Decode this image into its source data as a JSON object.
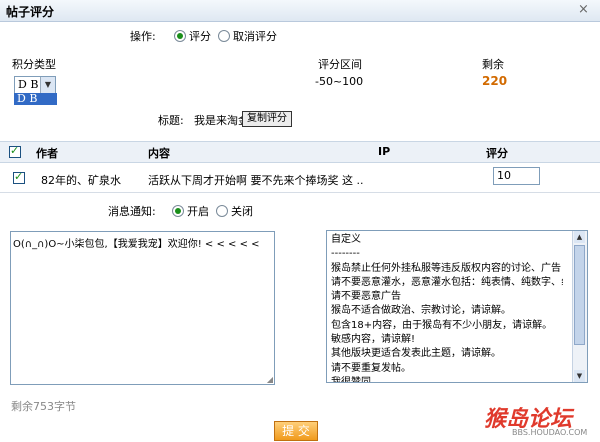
{
  "window": {
    "title": "帖子评分",
    "close": "×"
  },
  "operation": {
    "label": "操作:",
    "options": [
      "评分",
      "取消评分"
    ],
    "selected": 0
  },
  "credit_type": {
    "label": "积分类型",
    "selected": "D B",
    "dropdown_option": "D B"
  },
  "score_range": {
    "label": "评分区间",
    "value": "-50~100"
  },
  "remaining": {
    "label": "剩余",
    "value": "220",
    "color": "#d26a00"
  },
  "subject": {
    "label": "标题:",
    "value": "我是来淘金的",
    "copy_button": "复制评分"
  },
  "table": {
    "headers": [
      "作者",
      "内容",
      "IP",
      "评分"
    ],
    "rows": [
      {
        "author": "82年的、矿泉水",
        "content": "活跃从下周才开始啊 要不先来个捧场奖 这 ..",
        "ip": "",
        "score": "10"
      }
    ]
  },
  "notify": {
    "label": "消息通知:",
    "options": [
      "开启",
      "关闭"
    ],
    "selected": 0
  },
  "reason_text": "O(∩_∩)O~小柒包包,【我爱我宠】欢迎你! < < < < <",
  "preset_reasons": [
    "自定义",
    "--------",
    "猴岛禁止任何外挂私服等违反版权内容的讨论、广告",
    "请不要恶意灌水，恶意灌水包括：纯表情、纯数字、纟",
    "请不要恶意广告",
    "猴岛不适合做政治、宗教讨论，请谅解。",
    "包含18+内容，由于猴岛有不少小朋友，请谅解。",
    "敏感内容，请谅解!",
    "其他版块更适合发表此主题，请谅解。",
    "请不要重复发帖。",
    "我很赞同"
  ],
  "chars_left": "剩余753字节",
  "submit": "提 交",
  "watermark": {
    "logo": "猴岛论坛",
    "url": "BBS.HOUDAO.COM"
  }
}
